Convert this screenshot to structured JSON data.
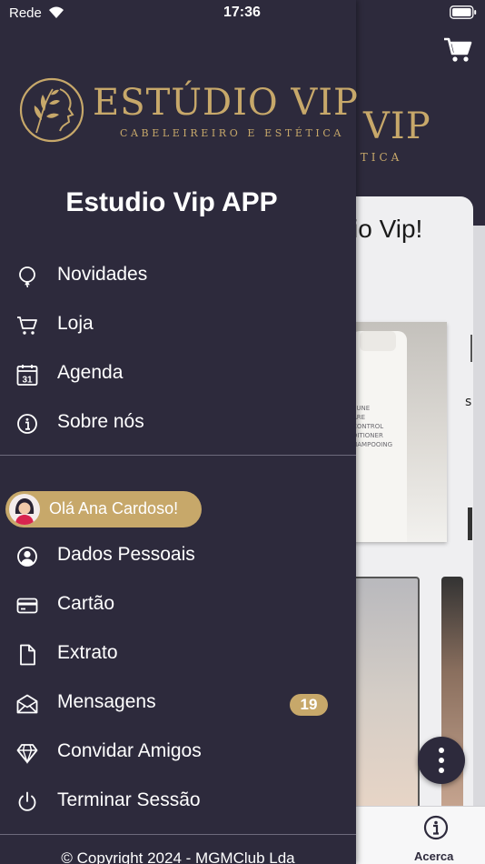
{
  "status_bar": {
    "carrier": "Rede",
    "time": "17:36"
  },
  "brand": {
    "logo_title": "ESTÚDIO VIP",
    "logo_subtitle": "CABELEIREIRO E ESTÉTICA",
    "gold": "#c7a86a",
    "background": "#2d2a3c"
  },
  "drawer": {
    "app_title": "Estudio Vip APP",
    "main_items": [
      {
        "label": "Novidades",
        "icon": "balloon-icon"
      },
      {
        "label": "Loja",
        "icon": "cart-icon"
      },
      {
        "label": "Agenda",
        "icon": "calendar-icon",
        "icon_text": "31"
      },
      {
        "label": "Sobre nós",
        "icon": "info-icon"
      }
    ],
    "greeting": "Olá Ana Cardoso!",
    "account_items": [
      {
        "label": "Dados Pessoais",
        "icon": "user-circle-icon"
      },
      {
        "label": "Cartão",
        "icon": "credit-card-icon"
      },
      {
        "label": "Extrato",
        "icon": "document-icon"
      },
      {
        "label": "Mensagens",
        "icon": "envelope-icon",
        "badge": "19"
      },
      {
        "label": "Convidar Amigos",
        "icon": "diamond-icon"
      },
      {
        "label": "Terminar Sessão",
        "icon": "power-icon"
      }
    ],
    "copyright": "© Copyright 2024 - MGMClub Lda"
  },
  "background_app": {
    "header_logo_partial": "VIP",
    "header_logo_sub_partial": "ÉTICA",
    "welcome_partial": "io Vip!",
    "side_letter": "s",
    "product_label_lines": [
      "EUNE",
      "ARE",
      "CONTROL",
      "DITIONER",
      "HAMPOOING"
    ],
    "tab_label": "Acerca"
  }
}
